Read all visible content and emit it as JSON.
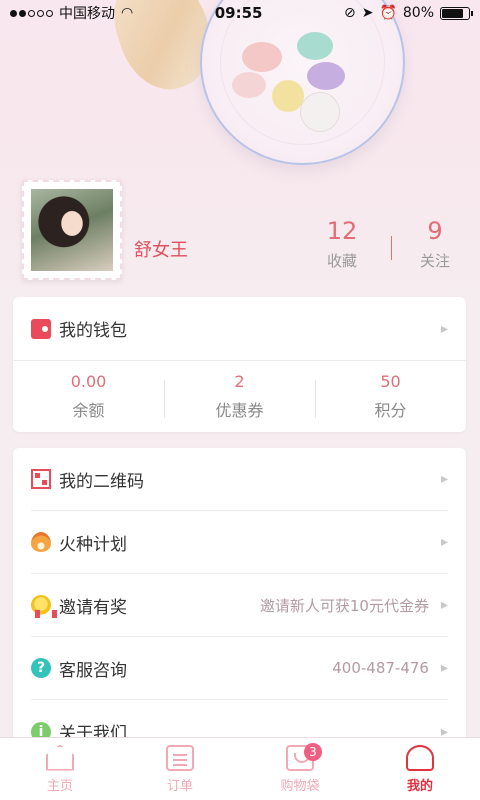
{
  "status_bar": {
    "carrier": "中国移动",
    "time": "09:55",
    "battery": "80%"
  },
  "profile": {
    "name": "舒女王",
    "stats": [
      {
        "count": "12",
        "label": "收藏"
      },
      {
        "count": "9",
        "label": "关注"
      }
    ]
  },
  "wallet": {
    "title": "我的钱包",
    "stats": [
      {
        "value": "0.00",
        "label": "余额"
      },
      {
        "value": "2",
        "label": "优惠券"
      },
      {
        "value": "50",
        "label": "积分"
      }
    ]
  },
  "menu": [
    {
      "label": "我的二维码",
      "extra": "",
      "icon": "qr-code-icon"
    },
    {
      "label": "火种计划",
      "extra": "",
      "icon": "fire-icon"
    },
    {
      "label": "邀请有奖",
      "extra": "邀请新人可获10元代金券",
      "icon": "medal-icon"
    },
    {
      "label": "客服咨询",
      "extra": "400-487-476",
      "icon": "help-icon"
    },
    {
      "label": "关于我们",
      "extra": "",
      "icon": "info-icon"
    }
  ],
  "tabs": [
    {
      "label": "主页",
      "icon": "home-icon"
    },
    {
      "label": "订单",
      "icon": "order-icon"
    },
    {
      "label": "购物袋",
      "icon": "bag-icon",
      "badge": "3"
    },
    {
      "label": "我的",
      "icon": "user-icon",
      "active": true
    }
  ],
  "colors": {
    "accent": "#e2323f",
    "accent_soft": "#e26d78",
    "background": "#f6edf0"
  }
}
